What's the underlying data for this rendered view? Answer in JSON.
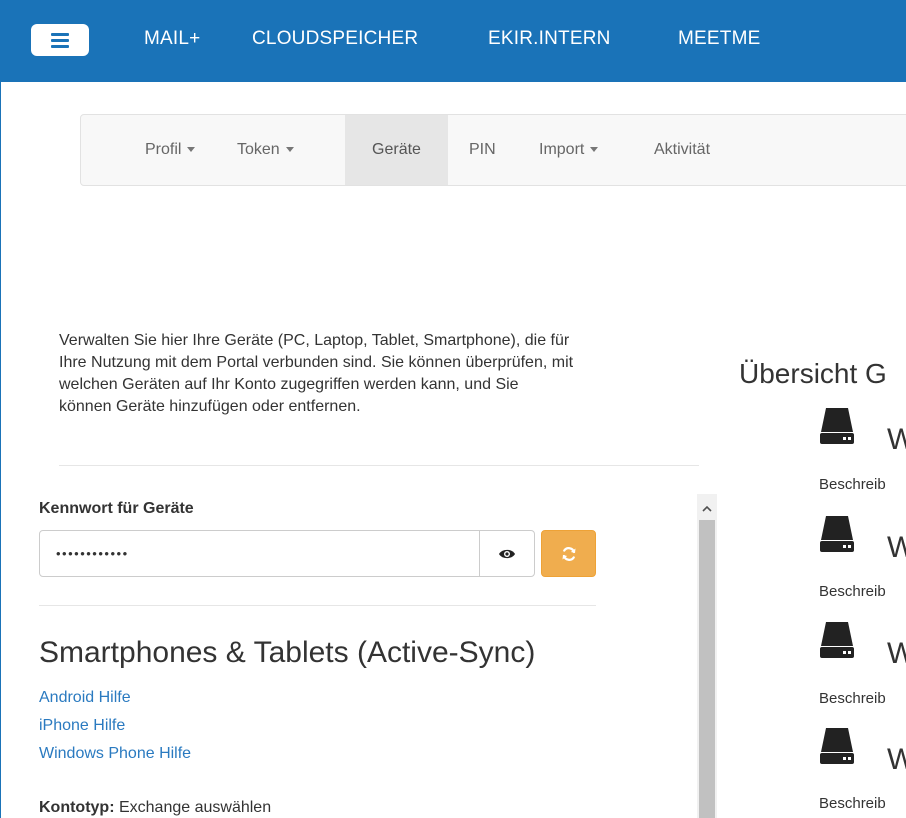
{
  "topnav": {
    "items": [
      "MAIL+",
      "CLOUDSPEICHER",
      "EKIR.INTERN",
      "MEETME"
    ]
  },
  "subnav": {
    "tabs": [
      {
        "label": "Profil",
        "dropdown": true
      },
      {
        "label": "Token",
        "dropdown": true
      },
      {
        "label": "Geräte",
        "dropdown": false,
        "active": true
      },
      {
        "label": "PIN",
        "dropdown": false
      },
      {
        "label": "Import",
        "dropdown": true
      },
      {
        "label": "Aktivität",
        "dropdown": false
      }
    ]
  },
  "intro": {
    "lines": [
      "Verwalten Sie hier Ihre Geräte (PC, Laptop, Tablet, Smartphone), die für",
      "Ihre Nutzung mit dem Portal verbunden sind. Sie können überprüfen, mit",
      "welchen Geräten auf Ihr Konto zugegriffen werden kann, und Sie",
      "können Geräte hinzufügen oder entfernen."
    ]
  },
  "password": {
    "label": "Kennwort für Geräte",
    "value": "••••••••••••"
  },
  "activesync": {
    "title": "Smartphones & Tablets (Active-Sync)",
    "links": [
      "Android Hilfe",
      "iPhone Hilfe",
      "Windows Phone Hilfe"
    ],
    "konto_label": "Kontotyp:",
    "konto_value": " Exchange auswählen"
  },
  "overview": {
    "title": "Übersicht G",
    "devices": [
      {
        "name": "W",
        "desc": "Beschreib"
      },
      {
        "name": "W",
        "desc": "Beschreib"
      },
      {
        "name": "W",
        "desc": "Beschreib"
      },
      {
        "name": "W",
        "desc": "Beschreib"
      }
    ]
  },
  "colors": {
    "navbar": "#1a73b8",
    "link": "#2a7ac0",
    "refresh_button": "#f0ad4e"
  }
}
